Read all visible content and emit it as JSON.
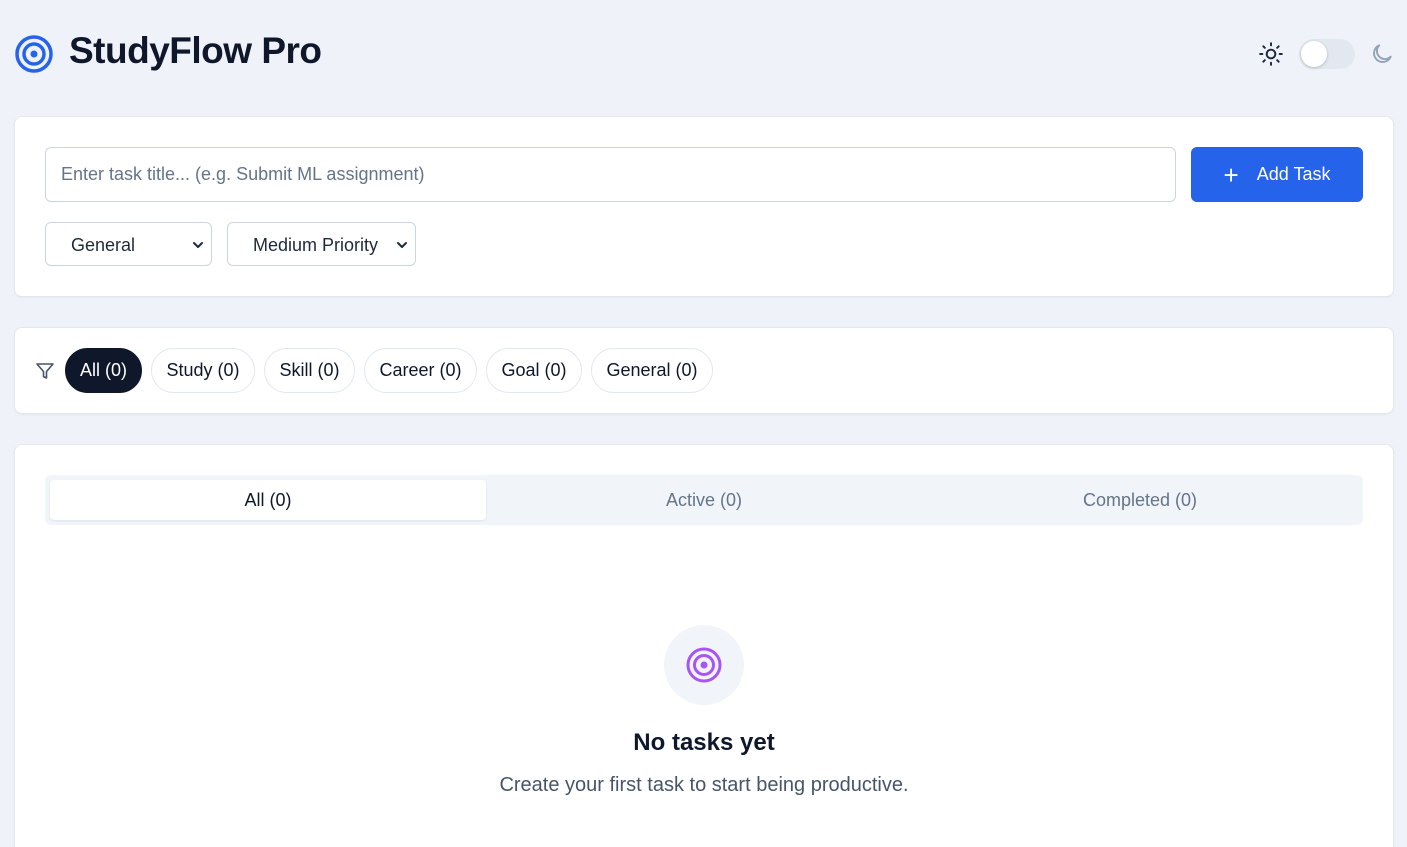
{
  "app": {
    "title": "StudyFlow Pro"
  },
  "header": {
    "logo_icon": "target-icon",
    "theme_light_icon": "sun-icon",
    "theme_dark_icon": "moon-icon",
    "dark_mode_enabled": false
  },
  "add_task": {
    "input_placeholder": "Enter task title... (e.g. Submit ML assignment)",
    "input_value": "",
    "button_label": "Add Task",
    "button_icon": "plus-icon",
    "category_selected": "General",
    "priority_selected": "Medium Priority"
  },
  "category_filter": {
    "icon": "filter-icon",
    "chips": [
      {
        "label": "All (0)",
        "active": true
      },
      {
        "label": "Study (0)",
        "active": false
      },
      {
        "label": "Skill (0)",
        "active": false
      },
      {
        "label": "Career (0)",
        "active": false
      },
      {
        "label": "Goal (0)",
        "active": false
      },
      {
        "label": "General (0)",
        "active": false
      }
    ]
  },
  "status_tabs": [
    {
      "label": "All (0)",
      "active": true
    },
    {
      "label": "Active (0)",
      "active": false
    },
    {
      "label": "Completed (0)",
      "active": false
    }
  ],
  "empty_state": {
    "icon": "target-icon",
    "title": "No tasks yet",
    "subtitle": "Create your first task to start being productive."
  },
  "colors": {
    "accent": "#2563eb",
    "dark_chip": "#0f172a",
    "empty_icon": "#a855f7",
    "background": "#eff2f9"
  }
}
